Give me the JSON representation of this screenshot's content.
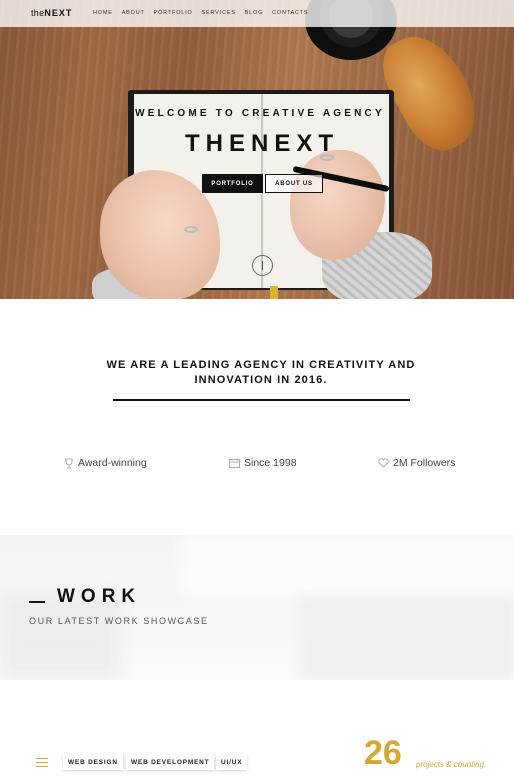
{
  "brand": {
    "prefix": "the",
    "name": "NEXT"
  },
  "nav": {
    "items": [
      "HOME",
      "ABOUT",
      "PORTFOLIO",
      "SERVICES",
      "BLOG",
      "CONTACTS"
    ]
  },
  "hero": {
    "subtitle": "WELCOME TO CREATIVE AGENCY",
    "title": "THENEXT",
    "primary_button": "PORTFOLIO",
    "secondary_button": "ABOUT US"
  },
  "about": {
    "headline_line1": "WE ARE A LEADING AGENCY IN CREATIVITY AND",
    "headline_line2": "INNOVATION IN 2016.",
    "features": [
      {
        "icon": "trophy-icon",
        "label": "Award-winning"
      },
      {
        "icon": "calendar-icon",
        "label": "Since 1998"
      },
      {
        "icon": "heart-icon",
        "label": "2M Followers"
      }
    ]
  },
  "work": {
    "title": "WORK",
    "subtitle": "OUR LATEST WORK SHOWCASE"
  },
  "filters": {
    "tags": [
      "WEB DESIGN",
      "WEB DEVELOPMENT",
      "UI/UX"
    ]
  },
  "projects": {
    "count": "26",
    "label": "projects & counting."
  },
  "colors": {
    "accent": "#d4a832",
    "dark": "#111111"
  }
}
